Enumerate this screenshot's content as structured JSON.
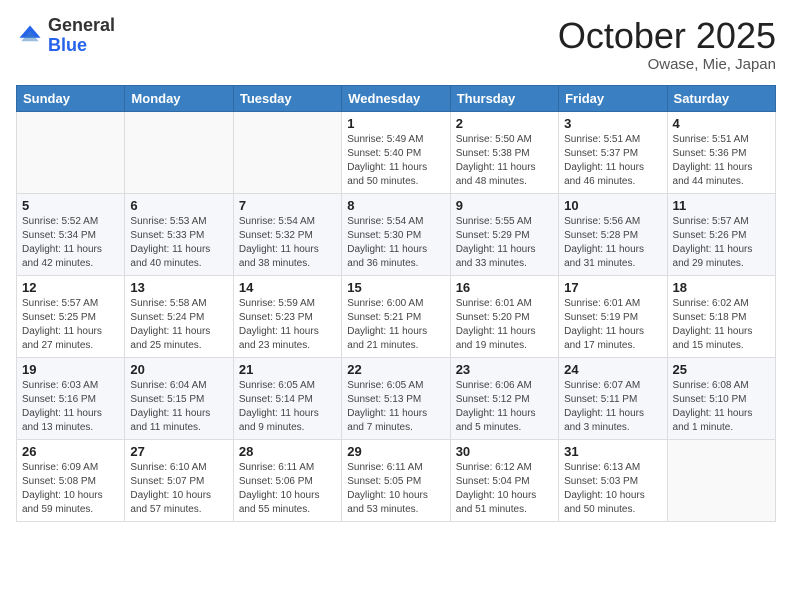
{
  "logo": {
    "general": "General",
    "blue": "Blue"
  },
  "header": {
    "month": "October 2025",
    "location": "Owase, Mie, Japan"
  },
  "weekdays": [
    "Sunday",
    "Monday",
    "Tuesday",
    "Wednesday",
    "Thursday",
    "Friday",
    "Saturday"
  ],
  "weeks": [
    [
      {
        "day": "",
        "info": ""
      },
      {
        "day": "",
        "info": ""
      },
      {
        "day": "",
        "info": ""
      },
      {
        "day": "1",
        "info": "Sunrise: 5:49 AM\nSunset: 5:40 PM\nDaylight: 11 hours\nand 50 minutes."
      },
      {
        "day": "2",
        "info": "Sunrise: 5:50 AM\nSunset: 5:38 PM\nDaylight: 11 hours\nand 48 minutes."
      },
      {
        "day": "3",
        "info": "Sunrise: 5:51 AM\nSunset: 5:37 PM\nDaylight: 11 hours\nand 46 minutes."
      },
      {
        "day": "4",
        "info": "Sunrise: 5:51 AM\nSunset: 5:36 PM\nDaylight: 11 hours\nand 44 minutes."
      }
    ],
    [
      {
        "day": "5",
        "info": "Sunrise: 5:52 AM\nSunset: 5:34 PM\nDaylight: 11 hours\nand 42 minutes."
      },
      {
        "day": "6",
        "info": "Sunrise: 5:53 AM\nSunset: 5:33 PM\nDaylight: 11 hours\nand 40 minutes."
      },
      {
        "day": "7",
        "info": "Sunrise: 5:54 AM\nSunset: 5:32 PM\nDaylight: 11 hours\nand 38 minutes."
      },
      {
        "day": "8",
        "info": "Sunrise: 5:54 AM\nSunset: 5:30 PM\nDaylight: 11 hours\nand 36 minutes."
      },
      {
        "day": "9",
        "info": "Sunrise: 5:55 AM\nSunset: 5:29 PM\nDaylight: 11 hours\nand 33 minutes."
      },
      {
        "day": "10",
        "info": "Sunrise: 5:56 AM\nSunset: 5:28 PM\nDaylight: 11 hours\nand 31 minutes."
      },
      {
        "day": "11",
        "info": "Sunrise: 5:57 AM\nSunset: 5:26 PM\nDaylight: 11 hours\nand 29 minutes."
      }
    ],
    [
      {
        "day": "12",
        "info": "Sunrise: 5:57 AM\nSunset: 5:25 PM\nDaylight: 11 hours\nand 27 minutes."
      },
      {
        "day": "13",
        "info": "Sunrise: 5:58 AM\nSunset: 5:24 PM\nDaylight: 11 hours\nand 25 minutes."
      },
      {
        "day": "14",
        "info": "Sunrise: 5:59 AM\nSunset: 5:23 PM\nDaylight: 11 hours\nand 23 minutes."
      },
      {
        "day": "15",
        "info": "Sunrise: 6:00 AM\nSunset: 5:21 PM\nDaylight: 11 hours\nand 21 minutes."
      },
      {
        "day": "16",
        "info": "Sunrise: 6:01 AM\nSunset: 5:20 PM\nDaylight: 11 hours\nand 19 minutes."
      },
      {
        "day": "17",
        "info": "Sunrise: 6:01 AM\nSunset: 5:19 PM\nDaylight: 11 hours\nand 17 minutes."
      },
      {
        "day": "18",
        "info": "Sunrise: 6:02 AM\nSunset: 5:18 PM\nDaylight: 11 hours\nand 15 minutes."
      }
    ],
    [
      {
        "day": "19",
        "info": "Sunrise: 6:03 AM\nSunset: 5:16 PM\nDaylight: 11 hours\nand 13 minutes."
      },
      {
        "day": "20",
        "info": "Sunrise: 6:04 AM\nSunset: 5:15 PM\nDaylight: 11 hours\nand 11 minutes."
      },
      {
        "day": "21",
        "info": "Sunrise: 6:05 AM\nSunset: 5:14 PM\nDaylight: 11 hours\nand 9 minutes."
      },
      {
        "day": "22",
        "info": "Sunrise: 6:05 AM\nSunset: 5:13 PM\nDaylight: 11 hours\nand 7 minutes."
      },
      {
        "day": "23",
        "info": "Sunrise: 6:06 AM\nSunset: 5:12 PM\nDaylight: 11 hours\nand 5 minutes."
      },
      {
        "day": "24",
        "info": "Sunrise: 6:07 AM\nSunset: 5:11 PM\nDaylight: 11 hours\nand 3 minutes."
      },
      {
        "day": "25",
        "info": "Sunrise: 6:08 AM\nSunset: 5:10 PM\nDaylight: 11 hours\nand 1 minute."
      }
    ],
    [
      {
        "day": "26",
        "info": "Sunrise: 6:09 AM\nSunset: 5:08 PM\nDaylight: 10 hours\nand 59 minutes."
      },
      {
        "day": "27",
        "info": "Sunrise: 6:10 AM\nSunset: 5:07 PM\nDaylight: 10 hours\nand 57 minutes."
      },
      {
        "day": "28",
        "info": "Sunrise: 6:11 AM\nSunset: 5:06 PM\nDaylight: 10 hours\nand 55 minutes."
      },
      {
        "day": "29",
        "info": "Sunrise: 6:11 AM\nSunset: 5:05 PM\nDaylight: 10 hours\nand 53 minutes."
      },
      {
        "day": "30",
        "info": "Sunrise: 6:12 AM\nSunset: 5:04 PM\nDaylight: 10 hours\nand 51 minutes."
      },
      {
        "day": "31",
        "info": "Sunrise: 6:13 AM\nSunset: 5:03 PM\nDaylight: 10 hours\nand 50 minutes."
      },
      {
        "day": "",
        "info": ""
      }
    ]
  ]
}
